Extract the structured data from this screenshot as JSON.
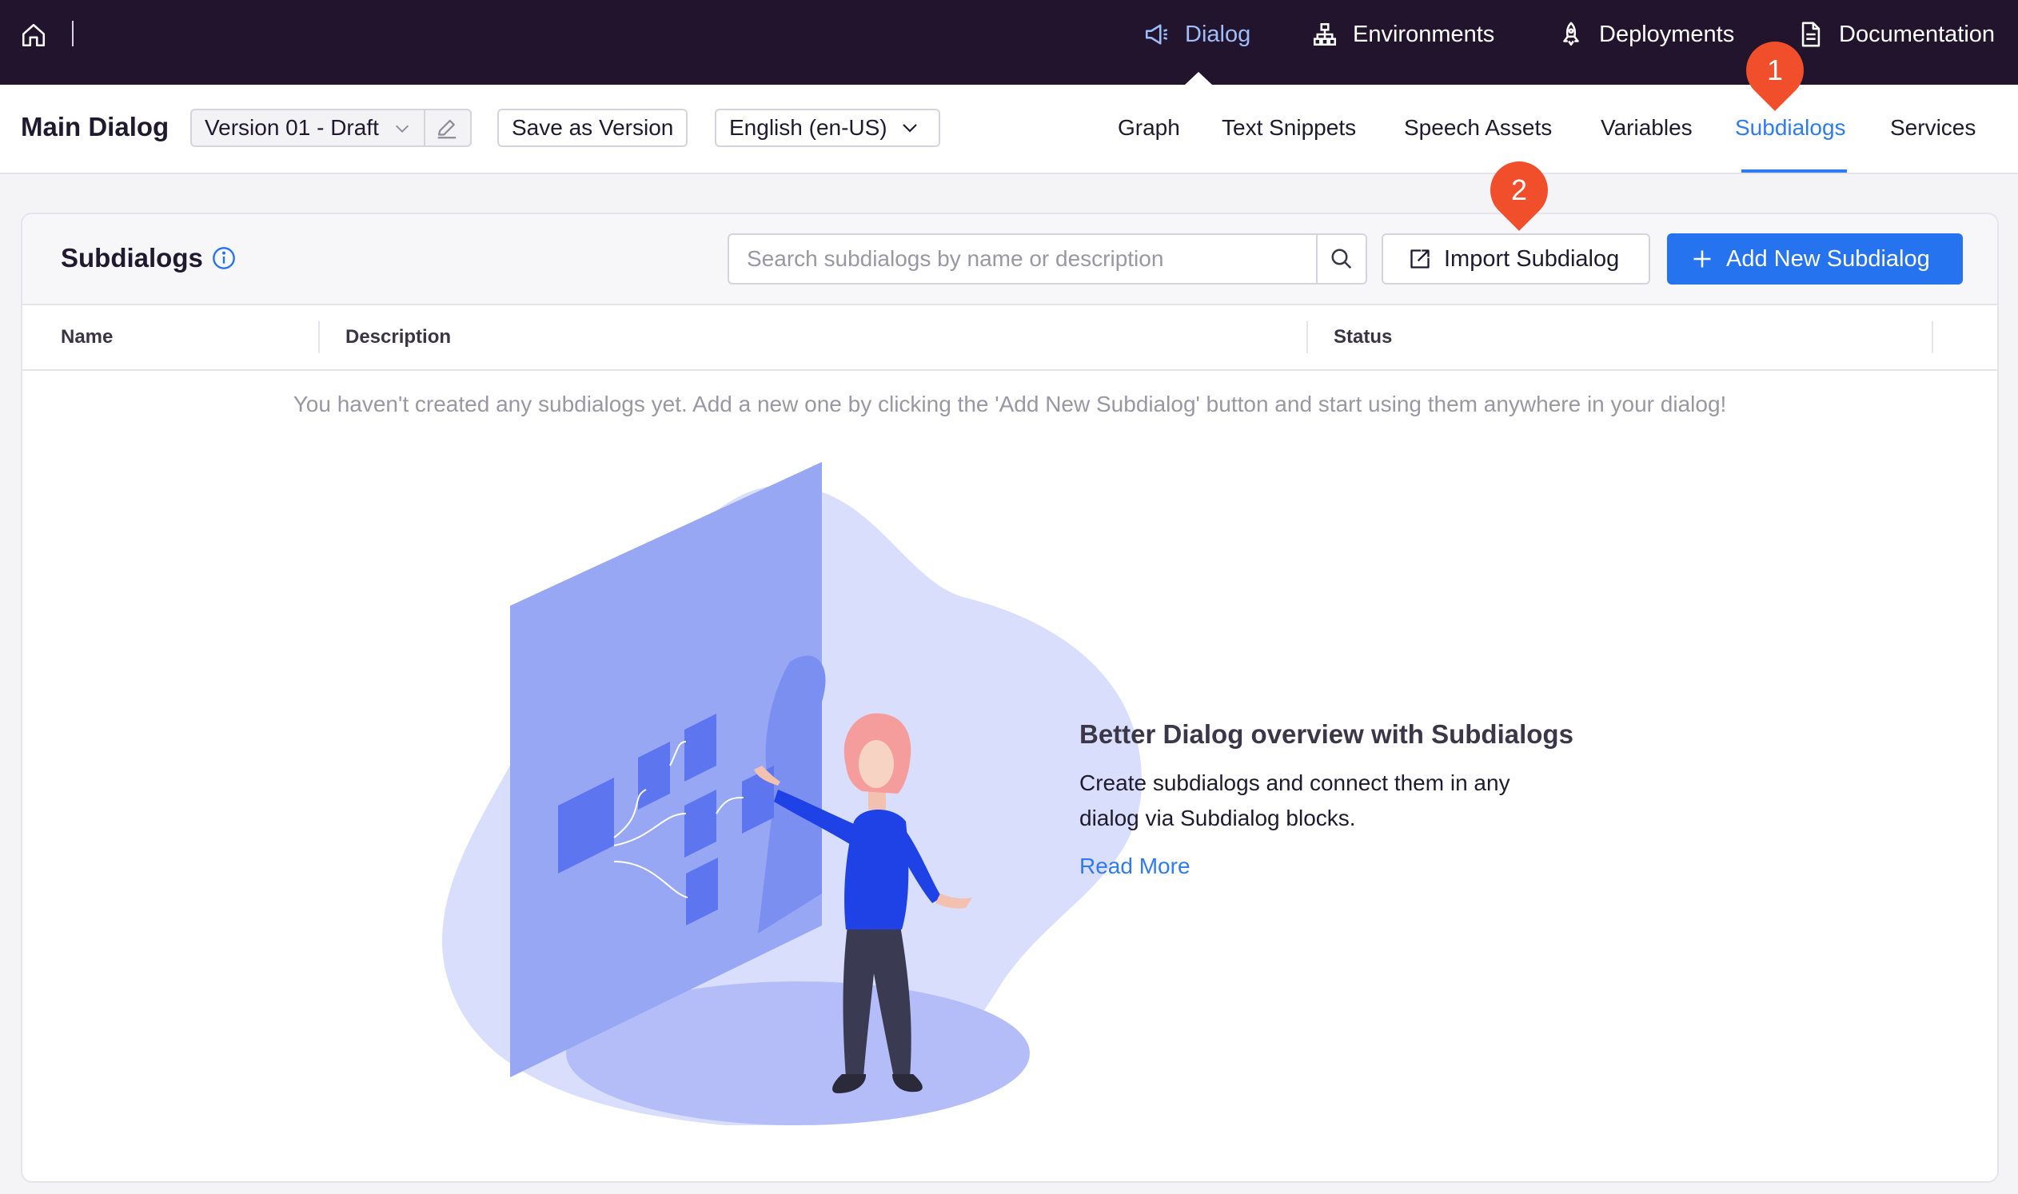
{
  "topnav": {
    "items": [
      {
        "label": "Dialog",
        "icon": "megaphone-icon",
        "active": true
      },
      {
        "label": "Environments",
        "icon": "sitemap-icon",
        "active": false
      },
      {
        "label": "Deployments",
        "icon": "rocket-icon",
        "active": false
      },
      {
        "label": "Documentation",
        "icon": "document-icon",
        "active": false
      }
    ],
    "active_color": "#9dbdfb",
    "background": "#23142d"
  },
  "subheader": {
    "title": "Main Dialog",
    "version_value": "Version 01 - Draft",
    "save_version_label": "Save as Version",
    "language_value": "English (en-US)",
    "tabs": [
      {
        "label": "Graph",
        "active": false
      },
      {
        "label": "Text Snippets",
        "active": false
      },
      {
        "label": "Speech Assets",
        "active": false
      },
      {
        "label": "Variables",
        "active": false
      },
      {
        "label": "Subdialogs",
        "active": true
      },
      {
        "label": "Services",
        "active": false
      }
    ]
  },
  "markers": [
    {
      "label": "1"
    },
    {
      "label": "2"
    }
  ],
  "card": {
    "title": "Subdialogs",
    "search_placeholder": "Search subdialogs by name or description",
    "import_label": "Import Subdialog",
    "add_label": "Add New Subdialog",
    "columns": [
      "Name",
      "Description",
      "Status"
    ],
    "empty_message": "You haven't created any subdialogs yet. Add a new one by clicking the 'Add New Subdialog' button and start using them anywhere in your dialog!",
    "promo": {
      "title": "Better Dialog overview with Subdialogs",
      "text_line1": "Create subdialogs and connect them in any",
      "text_line2": "dialog via Subdialog blocks.",
      "link": "Read More"
    }
  },
  "colors": {
    "accent": "#2673f0",
    "marker": "#f14e2b"
  }
}
